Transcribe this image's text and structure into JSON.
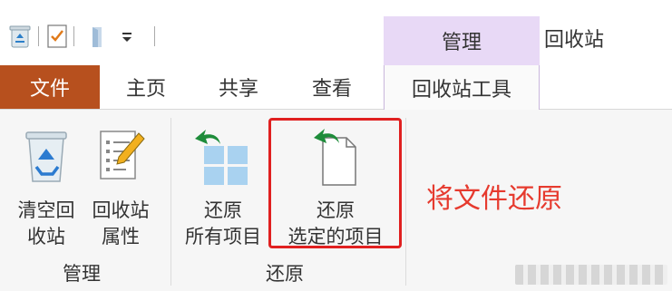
{
  "titlebar": {
    "contextual_tab": "管理",
    "window_title": "回收站"
  },
  "tabs": {
    "file": "文件",
    "home": "主页",
    "share": "共享",
    "view": "查看",
    "recycle_tools": "回收站工具"
  },
  "ribbon": {
    "empty_bin": [
      "清空回",
      "收站"
    ],
    "bin_properties": [
      "回收站",
      "属性"
    ],
    "restore_all": [
      "还原",
      "所有项目"
    ],
    "restore_selected": [
      "还原",
      "选定的项目"
    ],
    "group_manage": "管理",
    "group_restore": "还原"
  },
  "annotation": "将文件还原",
  "colors": {
    "file_tab_bg": "#b7501e",
    "contextual_bg": "#e8d9f6",
    "highlight": "#e02020",
    "annotation": "#e63a2e",
    "arrow_green": "#1e8c3a",
    "tile_blue": "#a9d2f0"
  }
}
